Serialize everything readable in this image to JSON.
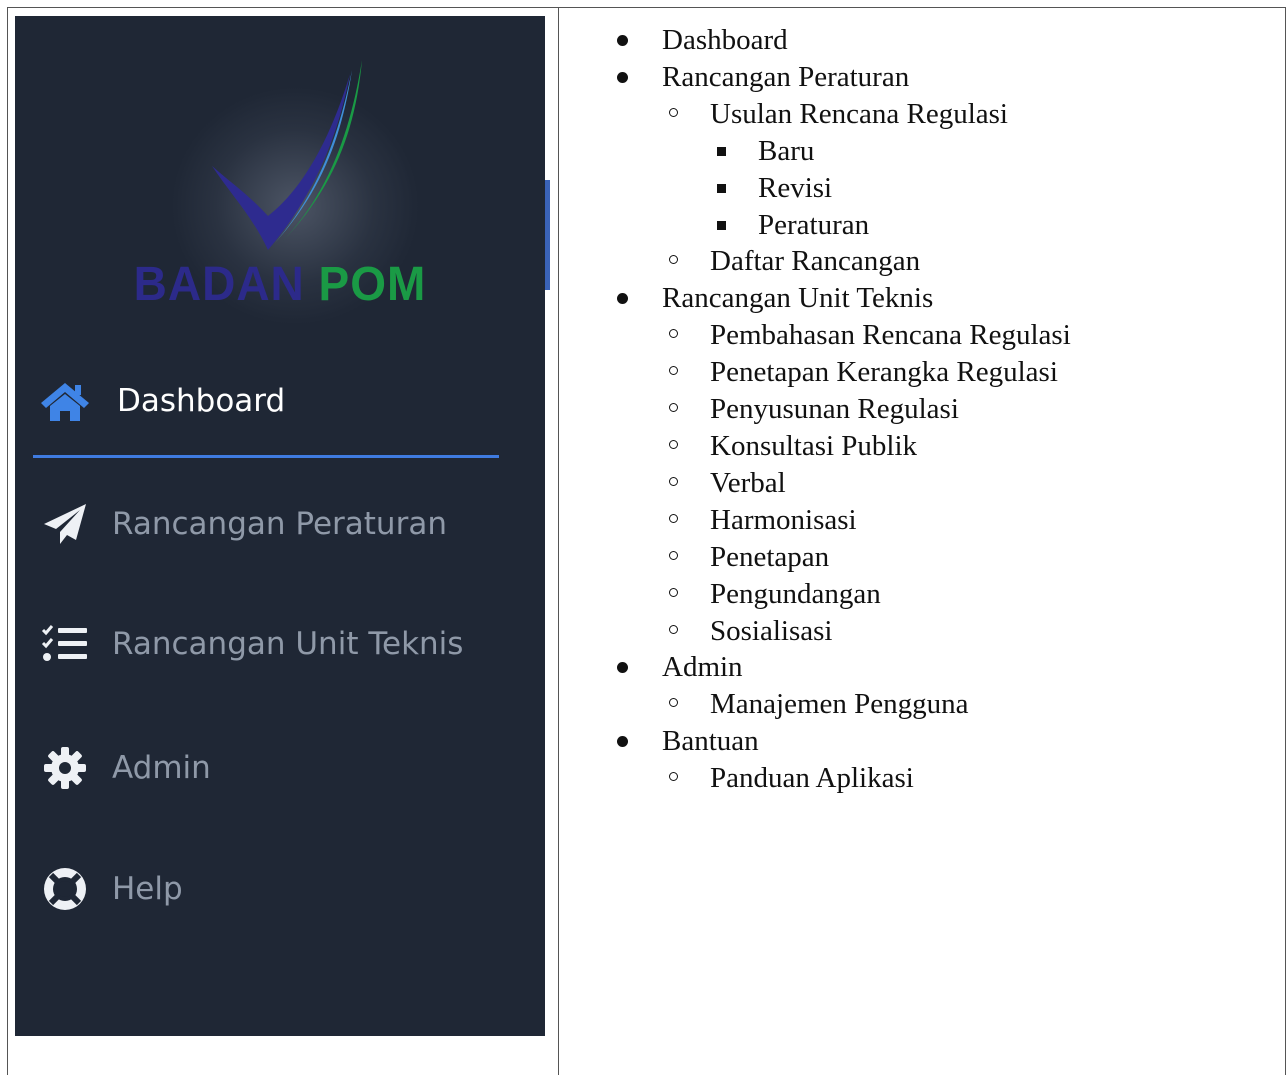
{
  "sidebar": {
    "logo": {
      "text_part1": "BADAN",
      "text_part2": "POM",
      "colors": {
        "blue": "#2c2a8a",
        "green": "#1a9a45",
        "background": "#1f2735"
      }
    },
    "items": [
      {
        "label": "Dashboard",
        "icon": "home-icon",
        "active": true
      },
      {
        "label": "Rancangan Peraturan",
        "icon": "paper-plane-icon",
        "active": false
      },
      {
        "label": "Rancangan Unit Teknis",
        "icon": "list-check-icon",
        "active": false
      },
      {
        "label": "Admin",
        "icon": "gear-icon",
        "active": false
      },
      {
        "label": "Help",
        "icon": "life-ring-icon",
        "active": false
      }
    ],
    "accent_color": "#3f7be0"
  },
  "outline": {
    "dashboard": "Dashboard",
    "rancangan_peraturan": {
      "label": "Rancangan Peraturan",
      "usulan": {
        "label": "Usulan Rencana Regulasi",
        "children": [
          "Baru",
          "Revisi",
          "Peraturan"
        ]
      },
      "daftar": "Daftar Rancangan"
    },
    "rancangan_unit_teknis": {
      "label": "Rancangan Unit Teknis",
      "children": [
        "Pembahasan Rencana Regulasi",
        "Penetapan Kerangka Regulasi",
        "Penyusunan Regulasi",
        "Konsultasi Publik",
        "Verbal",
        "Harmonisasi",
        "Penetapan",
        "Pengundangan",
        "Sosialisasi"
      ]
    },
    "admin": {
      "label": "Admin",
      "children": [
        "Manajemen Pengguna"
      ]
    },
    "bantuan": {
      "label": "Bantuan",
      "children": [
        "Panduan Aplikasi"
      ]
    }
  }
}
